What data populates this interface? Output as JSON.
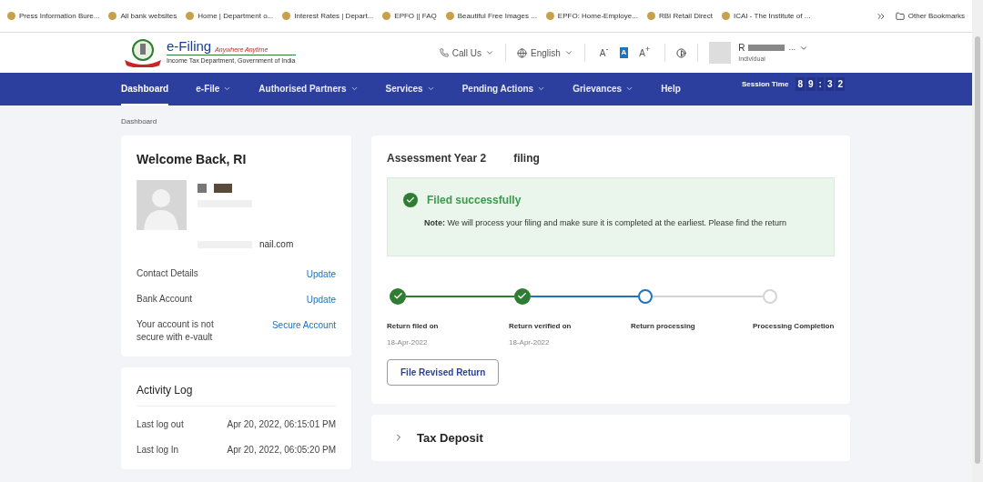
{
  "bookmarks": [
    {
      "label": "Press Information Bure..."
    },
    {
      "label": "All bank websites"
    },
    {
      "label": "Home | Department o..."
    },
    {
      "label": "Interest Rates | Depart..."
    },
    {
      "label": "EPFO || FAQ"
    },
    {
      "label": "Beautiful Free Images ..."
    },
    {
      "label": "EPFO: Home-Employe..."
    },
    {
      "label": "RBI Retail Direct"
    },
    {
      "label": "ICAI - The Institute of ..."
    }
  ],
  "other_bookmarks": "Other Bookmarks",
  "header": {
    "logo_title": "e-Filing",
    "logo_tagline": "Anywhere Anytime",
    "logo_subtitle": "Income Tax Department, Government of India",
    "call_us": "Call Us",
    "language": "English",
    "font_small": "A",
    "font_small_sign": "-",
    "font_normal": "A",
    "font_large": "A",
    "font_large_sign": "+",
    "user_initial": "R",
    "user_more": "...",
    "user_role": "Individual"
  },
  "nav": [
    {
      "label": "Dashboard",
      "selected": true,
      "dropdown": false
    },
    {
      "label": "e-File",
      "selected": false,
      "dropdown": true
    },
    {
      "label": "Authorised Partners",
      "selected": false,
      "dropdown": true
    },
    {
      "label": "Services",
      "selected": false,
      "dropdown": true
    },
    {
      "label": "Pending Actions",
      "selected": false,
      "dropdown": true
    },
    {
      "label": "Grievances",
      "selected": false,
      "dropdown": true
    },
    {
      "label": "Help",
      "selected": false,
      "dropdown": false
    }
  ],
  "session": {
    "label": "Session Time",
    "digits": [
      "8",
      "9",
      ":",
      "3",
      "2"
    ]
  },
  "breadcrumb": "Dashboard",
  "profile": {
    "welcome": "Welcome Back, RI",
    "email": "nail.com",
    "rows": [
      {
        "label": "Contact Details",
        "action": "Update"
      },
      {
        "label": "Bank Account",
        "action": "Update"
      },
      {
        "label": "Your account is not secure with e-vault",
        "action": "Secure Account"
      }
    ]
  },
  "activity": {
    "title": "Activity Log",
    "rows": [
      {
        "label": "Last log out",
        "value": "Apr 20, 2022, 06:15:01 PM"
      },
      {
        "label": "Last log In",
        "value": "Apr 20, 2022, 06:05:20 PM"
      }
    ]
  },
  "filing": {
    "title": "Assessment Year 2",
    "title_end": "filing",
    "status": "Filed successfully",
    "note": "**Note:** We will process your filing and make sure it is completed at the earliest. Please find the return",
    "steps": [
      {
        "label": "Return filed on",
        "date": "18-Apr-2022",
        "kind": "done"
      },
      {
        "label": "Return verified on",
        "date": "18-Apr-2022",
        "kind": "done"
      },
      {
        "label": "Return processing",
        "kind": "current"
      },
      {
        "label": "Processing Completion",
        "kind": "pending"
      }
    ],
    "button": "File Revised Return"
  },
  "tax_deposit": {
    "title": "Tax Deposit",
    "expanded": false
  }
}
